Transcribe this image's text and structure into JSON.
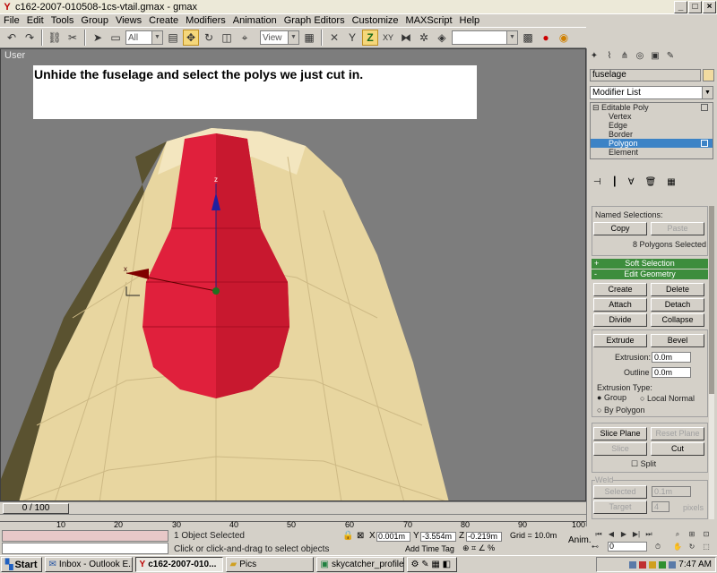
{
  "window": {
    "title": "c162-2007-010508-1cs-vtail.gmax - gmax"
  },
  "window_controls": {
    "minimize": "_",
    "maximize": "□",
    "close": "×"
  },
  "menu": [
    "File",
    "Edit",
    "Tools",
    "Group",
    "Views",
    "Create",
    "Modifiers",
    "Animation",
    "Graph Editors",
    "Customize",
    "MAXScript",
    "Help"
  ],
  "toolbar": {
    "selection_filter": "All",
    "ref_coord": "View",
    "named_selection": ""
  },
  "viewport": {
    "label": "User",
    "instruction": "Unhide the fuselage and select the polys we just cut in.",
    "gizmo_axes": {
      "z": "z",
      "x": "x"
    },
    "colors": {
      "background": "#7d7d7d",
      "fuselage": "#e8d6a0",
      "selected_polys": "#e0203c"
    }
  },
  "timeline": {
    "slider_label": "0 / 100",
    "ticks": [
      "10",
      "20",
      "30",
      "40",
      "50",
      "60",
      "70",
      "80",
      "90",
      "100"
    ]
  },
  "status": {
    "selection": "1 Object Selected",
    "prompt": "Click or click-and-drag to select objects",
    "x_label": "X",
    "x_value": "0.001m",
    "y_label": "Y",
    "y_value": "-3.554m",
    "z_label": "Z",
    "z_value": "-0.219m",
    "grid": "Grid = 10.0m",
    "add_time_tag": "Add Time Tag",
    "anim_label": "Anim.",
    "frame": "0"
  },
  "command_panel": {
    "object_name": "fuselage",
    "modifier_list": "Modifier List",
    "stack": {
      "root": "Editable Poly",
      "items": [
        "Vertex",
        "Edge",
        "Border",
        "Polygon",
        "Element"
      ],
      "selected": "Polygon"
    },
    "named_selections_label": "Named Selections:",
    "copy": "Copy",
    "paste": "Paste",
    "selection_count": "8 Polygons Selected",
    "soft_selection": {
      "sign": "+",
      "label": "Soft Selection"
    },
    "edit_geometry": {
      "sign": "-",
      "label": "Edit Geometry"
    },
    "buttons": {
      "create": "Create",
      "delete": "Delete",
      "attach": "Attach",
      "detach": "Detach",
      "divide": "Divide",
      "collapse": "Collapse",
      "extrude": "Extrude",
      "bevel": "Bevel",
      "slice_plane": "Slice Plane",
      "reset_plane": "Reset Plane",
      "slice": "Slice",
      "cut": "Cut",
      "selected": "Selected",
      "target": "Target"
    },
    "extrusion_label": "Extrusion:",
    "extrusion_value": "0.0m",
    "outline_label": "Outline",
    "outline_value": "0.0m",
    "extrusion_type_label": "Extrusion Type:",
    "ext_group": "Group",
    "ext_local_normal": "Local Normal",
    "ext_by_polygon": "By Polygon",
    "split": "Split",
    "weld_label": "Weld",
    "weld_value": "0.1m",
    "target_value": "4",
    "pixels": "pixels"
  },
  "taskbar": {
    "start": "Start",
    "tasks": [
      "Inbox - Outlook E...",
      "c162-2007-010...",
      "Pics",
      "skycatcher_profile...."
    ],
    "active_task": 1,
    "clock": "7:47 AM"
  }
}
